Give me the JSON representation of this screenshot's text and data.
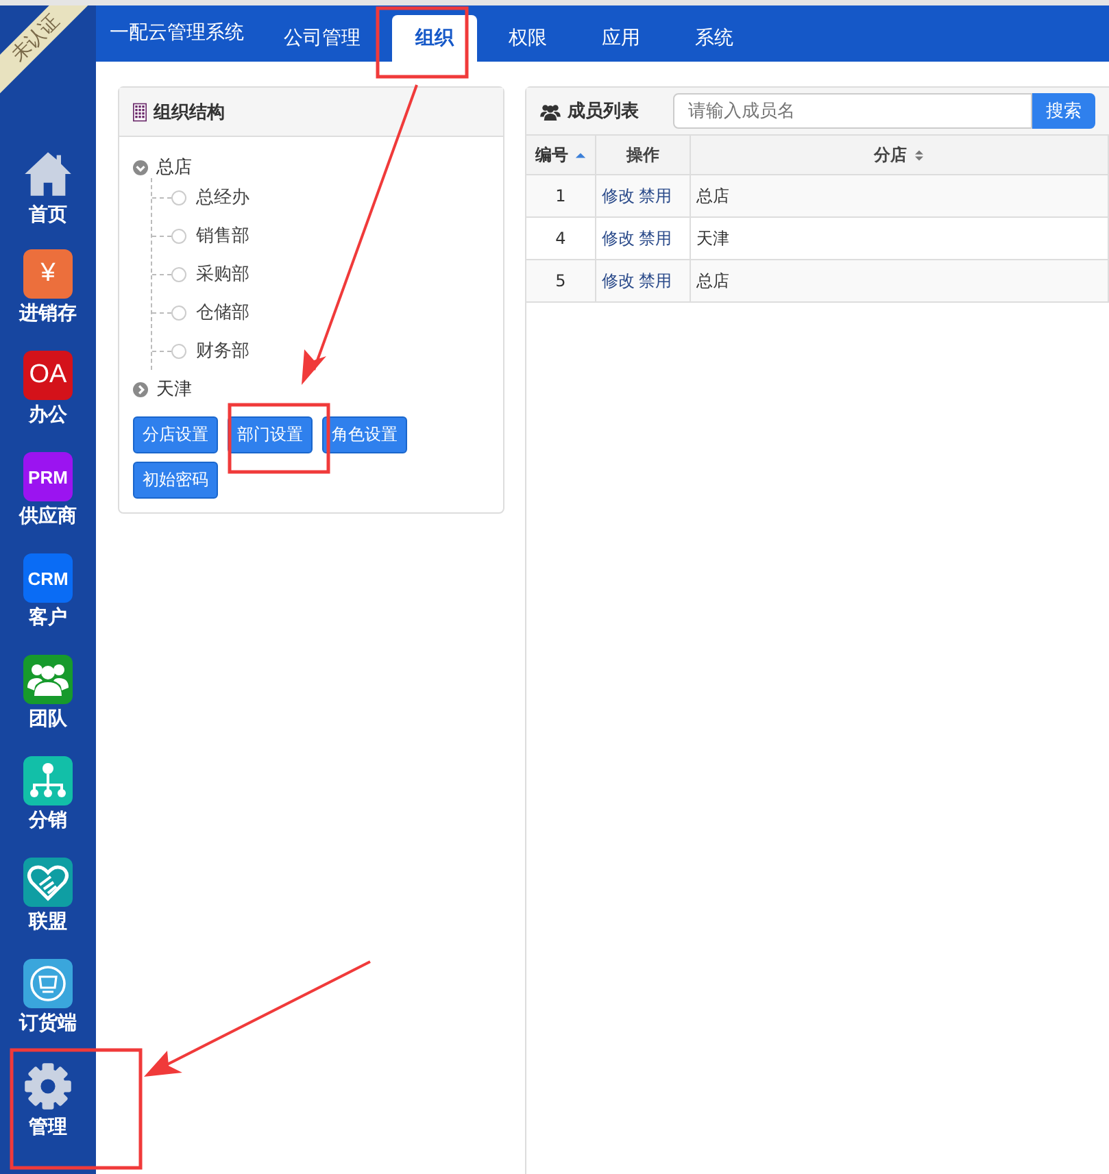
{
  "badge": "未认证",
  "sidebar": {
    "items": [
      {
        "label": "首页",
        "kind": "house"
      },
      {
        "label": "进销存",
        "kind": "text-tile",
        "glyph": "¥",
        "color": "#ec6f3c"
      },
      {
        "label": "办公",
        "kind": "text-tile",
        "glyph": "OA",
        "color": "#d4121a"
      },
      {
        "label": "供应商",
        "kind": "text-tile",
        "glyph": "PRM",
        "color": "#9b14f0"
      },
      {
        "label": "客户",
        "kind": "text-tile",
        "glyph": "CRM",
        "color": "#0a6cf5"
      },
      {
        "label": "团队",
        "kind": "people-tile",
        "color": "#179a2c"
      },
      {
        "label": "分销",
        "kind": "tree-tile",
        "color": "#12bfa8"
      },
      {
        "label": "联盟",
        "kind": "heart-tile",
        "color": "#0f9ea3"
      },
      {
        "label": "订货端",
        "kind": "cart-tile",
        "color": "#3aa6dc"
      },
      {
        "label": "管理",
        "kind": "gear"
      }
    ]
  },
  "topbar": {
    "brand": "一配云管理系统",
    "tabs": [
      {
        "label": "公司管理",
        "selected": false
      },
      {
        "label": "组织",
        "selected": true
      },
      {
        "label": "权限",
        "selected": false
      },
      {
        "label": "应用",
        "selected": false
      },
      {
        "label": "系统",
        "selected": false
      }
    ]
  },
  "org_panel": {
    "title": "组织结构",
    "tree": [
      {
        "label": "总店",
        "expanded": true,
        "children": [
          {
            "label": "总经办"
          },
          {
            "label": "销售部"
          },
          {
            "label": "采购部"
          },
          {
            "label": "仓储部"
          },
          {
            "label": "财务部"
          }
        ]
      },
      {
        "label": "天津",
        "expanded": false
      }
    ],
    "buttons": [
      "分店设置",
      "部门设置",
      "角色设置",
      "初始密码"
    ]
  },
  "member_panel": {
    "title": "成员列表",
    "search": {
      "placeholder": "请输入成员名",
      "button": "搜索"
    },
    "table": {
      "columns": [
        {
          "label": "编号",
          "sortable": true,
          "sorted": true
        },
        {
          "label": "操作",
          "sortable": false,
          "sorted": false
        },
        {
          "label": "分店",
          "sortable": true,
          "sorted": false
        }
      ],
      "rows": [
        {
          "id": "1",
          "actions": [
            "修改",
            "禁用"
          ],
          "branch": "总店"
        },
        {
          "id": "4",
          "actions": [
            "修改",
            "禁用"
          ],
          "branch": "天津"
        },
        {
          "id": "5",
          "actions": [
            "修改",
            "禁用"
          ],
          "branch": "总店"
        }
      ]
    }
  }
}
